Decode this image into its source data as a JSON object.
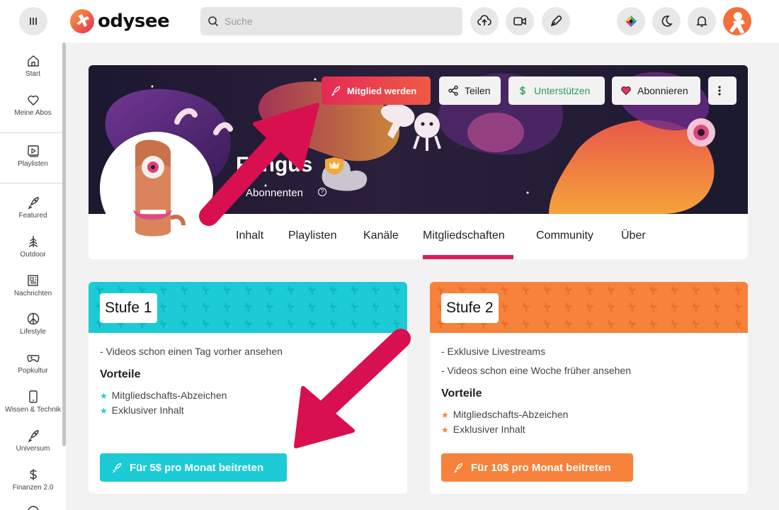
{
  "app": {
    "logo_text": "odysee",
    "brand_color": "#e42b55"
  },
  "search": {
    "placeholder": "Suche"
  },
  "header_buttons": [
    "upload-icon",
    "camera-icon",
    "pen-icon",
    "wallet-icon",
    "moon-icon",
    "bell-icon"
  ],
  "sidebar": {
    "items": [
      {
        "label": "Start",
        "icon": "home-icon"
      },
      {
        "label": "Meine Abos",
        "icon": "heart-icon"
      },
      {
        "label": "Playlisten",
        "icon": "playlist-icon"
      },
      {
        "label": "Featured",
        "icon": "rocket-icon"
      },
      {
        "label": "Outdoor",
        "icon": "tree-icon"
      },
      {
        "label": "Nachrichten",
        "icon": "newspaper-icon"
      },
      {
        "label": "Lifestyle",
        "icon": "peace-icon"
      },
      {
        "label": "Popkultur",
        "icon": "gamepad-icon"
      },
      {
        "label": "Wissen & Technik",
        "icon": "phone-icon"
      },
      {
        "label": "Universum",
        "icon": "rocket-icon"
      },
      {
        "label": "Finanzen 2.0",
        "icon": "dollar-icon"
      }
    ]
  },
  "channel": {
    "title": "Fungus",
    "subscribers": "Abonnenten",
    "actions": {
      "member": "Mitglied werden",
      "share": "Teilen",
      "support": "Unterstützen",
      "follow": "Abonnieren"
    },
    "tabs": [
      "Inhalt",
      "Playlisten",
      "Kanäle",
      "Mitgliedschaften",
      "Community",
      "Über"
    ],
    "active_tab": "Mitgliedschaften"
  },
  "tiers": [
    {
      "name": "Stufe 1",
      "color": "#1ccbd5",
      "perks": [
        "- Videos schon einen Tag vorher ansehen"
      ],
      "benefits_title": "Vorteile",
      "benefits": [
        "Mitgliedschafts-Abzeichen",
        "Exklusiver Inhalt"
      ],
      "join_label": "Für 5$ pro Monat beitreten"
    },
    {
      "name": "Stufe 2",
      "color": "#f6823b",
      "perks": [
        "- Exklusive Livestreams",
        "- Videos schon eine Woche früher ansehen"
      ],
      "benefits_title": "Vorteile",
      "benefits": [
        "Mitgliedschafts-Abzeichen",
        "Exklusiver Inhalt"
      ],
      "join_label": "Für 10$ pro Monat beitreten"
    }
  ]
}
